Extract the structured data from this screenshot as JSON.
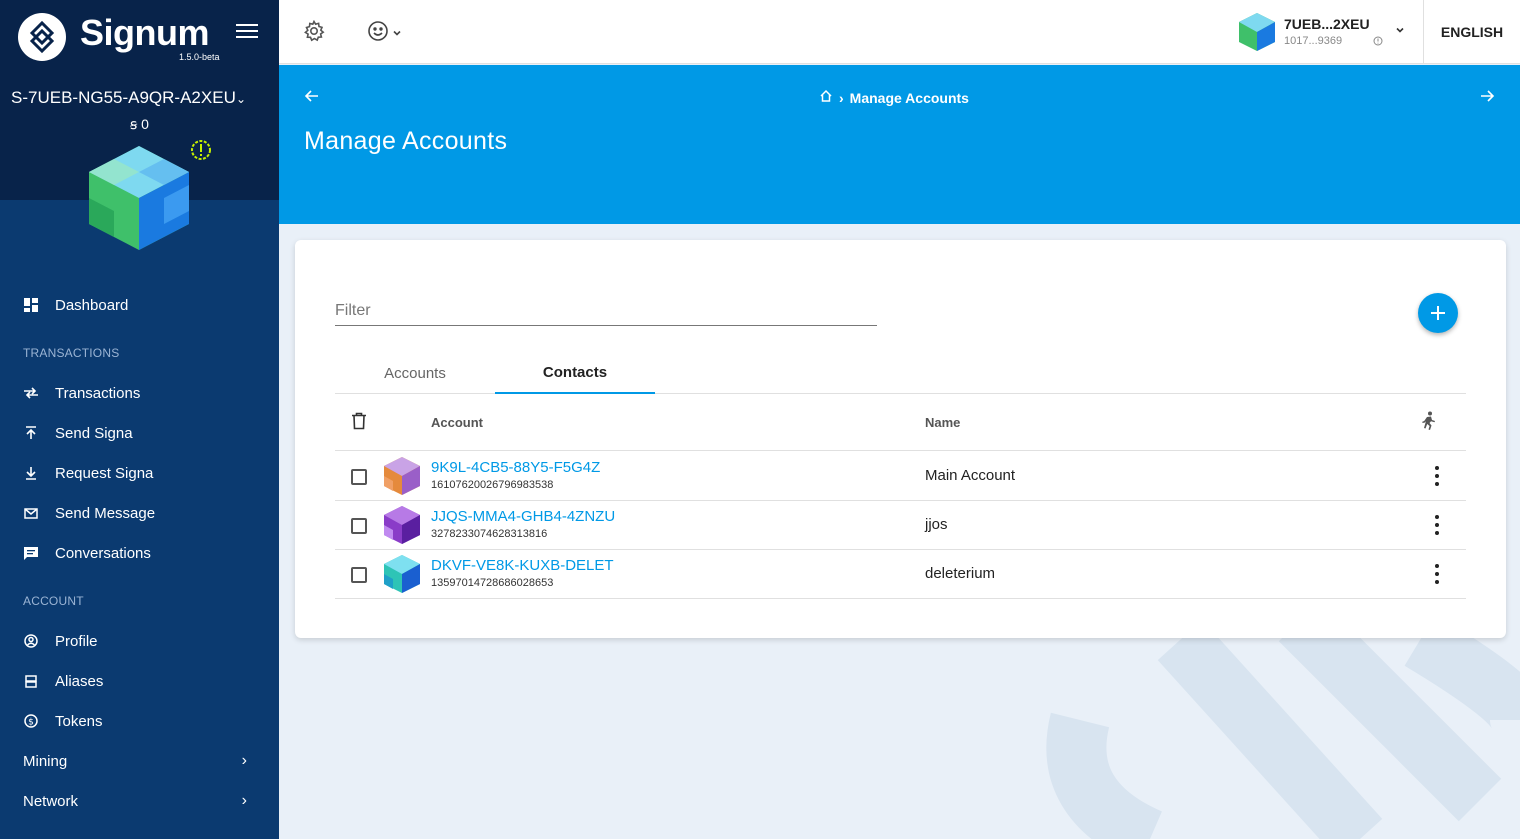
{
  "sidebar": {
    "brand": "Signum",
    "version": "1.5.0-beta",
    "account_id": "S-7UEB-NG55-A9QR-A2XEU",
    "balance": "ꞩ 0",
    "dashboard": "Dashboard",
    "transactions_heading": "TRANSACTIONS",
    "transactions": "Transactions",
    "send": "Send Signa",
    "request": "Request Signa",
    "send_message": "Send Message",
    "conversations": "Conversations",
    "account_heading": "ACCOUNT",
    "profile": "Profile",
    "aliases": "Aliases",
    "tokens": "Tokens",
    "mining": "Mining",
    "network": "Network"
  },
  "topbar": {
    "account_short": "7UEB...2XEU",
    "account_num": "1017...9369",
    "language": "ENGLISH"
  },
  "header": {
    "breadcrumb": "Manage Accounts",
    "title": "Manage Accounts"
  },
  "card": {
    "filter_placeholder": "Filter",
    "tab_accounts": "Accounts",
    "tab_contacts": "Contacts",
    "col_account": "Account",
    "col_name": "Name",
    "rows": [
      {
        "address": "9K9L-4CB5-88Y5-F5G4Z",
        "numeric": "16107620026796983538",
        "name": "Main Account"
      },
      {
        "address": "JJQS-MMA4-GHB4-4ZNZU",
        "numeric": "3278233074628313816",
        "name": "jjos"
      },
      {
        "address": "DKVF-VE8K-KUXB-DELET",
        "numeric": "13597014728686028653",
        "name": "deleterium"
      }
    ]
  },
  "colors": {
    "accent": "#0099e6",
    "sidebar": "#0b3a70",
    "sidebar_top": "#08234a",
    "background": "#e9f0f8"
  }
}
